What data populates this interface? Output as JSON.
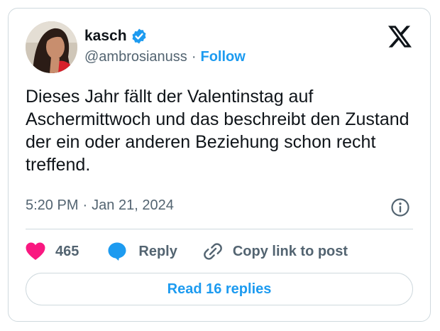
{
  "author": {
    "display_name": "kasch",
    "handle": "@ambrosianuss",
    "separator": "·",
    "follow_label": "Follow",
    "avatar_icon": "user-avatar-photo",
    "verified_icon": "verified-badge-icon"
  },
  "brand": {
    "logo_icon": "x-logo-icon"
  },
  "tweet": {
    "text": "Dieses Jahr fällt der Valentinstag auf Aschermittwoch und das beschreibt den Zustand der ein oder anderen Beziehung schon recht treffend.",
    "time": "5:20 PM",
    "separator": "·",
    "date": "Jan 21, 2024"
  },
  "actions": {
    "like_count": "465",
    "reply_label": "Reply",
    "copy_link_label": "Copy link to post",
    "read_replies_label": "Read 16 replies"
  },
  "colors": {
    "accent": "#1d9bf0",
    "like": "#f91880",
    "text": "#0f1419",
    "secondary": "#536471",
    "border": "#cfd9de"
  }
}
